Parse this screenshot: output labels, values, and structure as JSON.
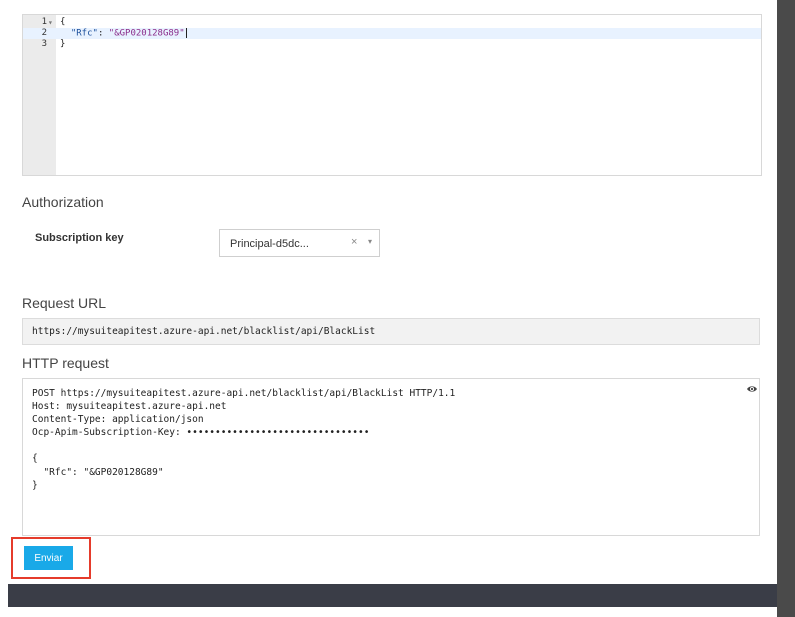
{
  "editor": {
    "lines": [
      {
        "num": "1",
        "fold": "▾",
        "text": "{"
      },
      {
        "num": "2",
        "fold": "",
        "key": "\"Rfc\"",
        "sep": ": ",
        "value": "\"&GP020128G89\""
      },
      {
        "num": "3",
        "fold": "",
        "text": "}"
      }
    ]
  },
  "authorization": {
    "title": "Authorization",
    "subscription_label": "Subscription key",
    "subscription_value": "Principal-d5dc...",
    "clear_glyph": "×",
    "arrow_glyph": "▾"
  },
  "request_url": {
    "title": "Request URL",
    "value": "https://mysuiteapitest.azure-api.net/blacklist/api/BlackList"
  },
  "http_request": {
    "title": "HTTP request",
    "lines": [
      "POST https://mysuiteapitest.azure-api.net/blacklist/api/BlackList HTTP/1.1",
      "Host: mysuiteapitest.azure-api.net",
      "Content-Type: application/json",
      "Ocp-Apim-Subscription-Key: ••••••••••••••••••••••••••••••••",
      "",
      "{",
      "  \"Rfc\": \"&GP020128G89\"",
      "}"
    ]
  },
  "send_button": {
    "label": "Enviar"
  },
  "colors": {
    "accent": "#19a9e8",
    "highlight": "#e53b2b"
  }
}
